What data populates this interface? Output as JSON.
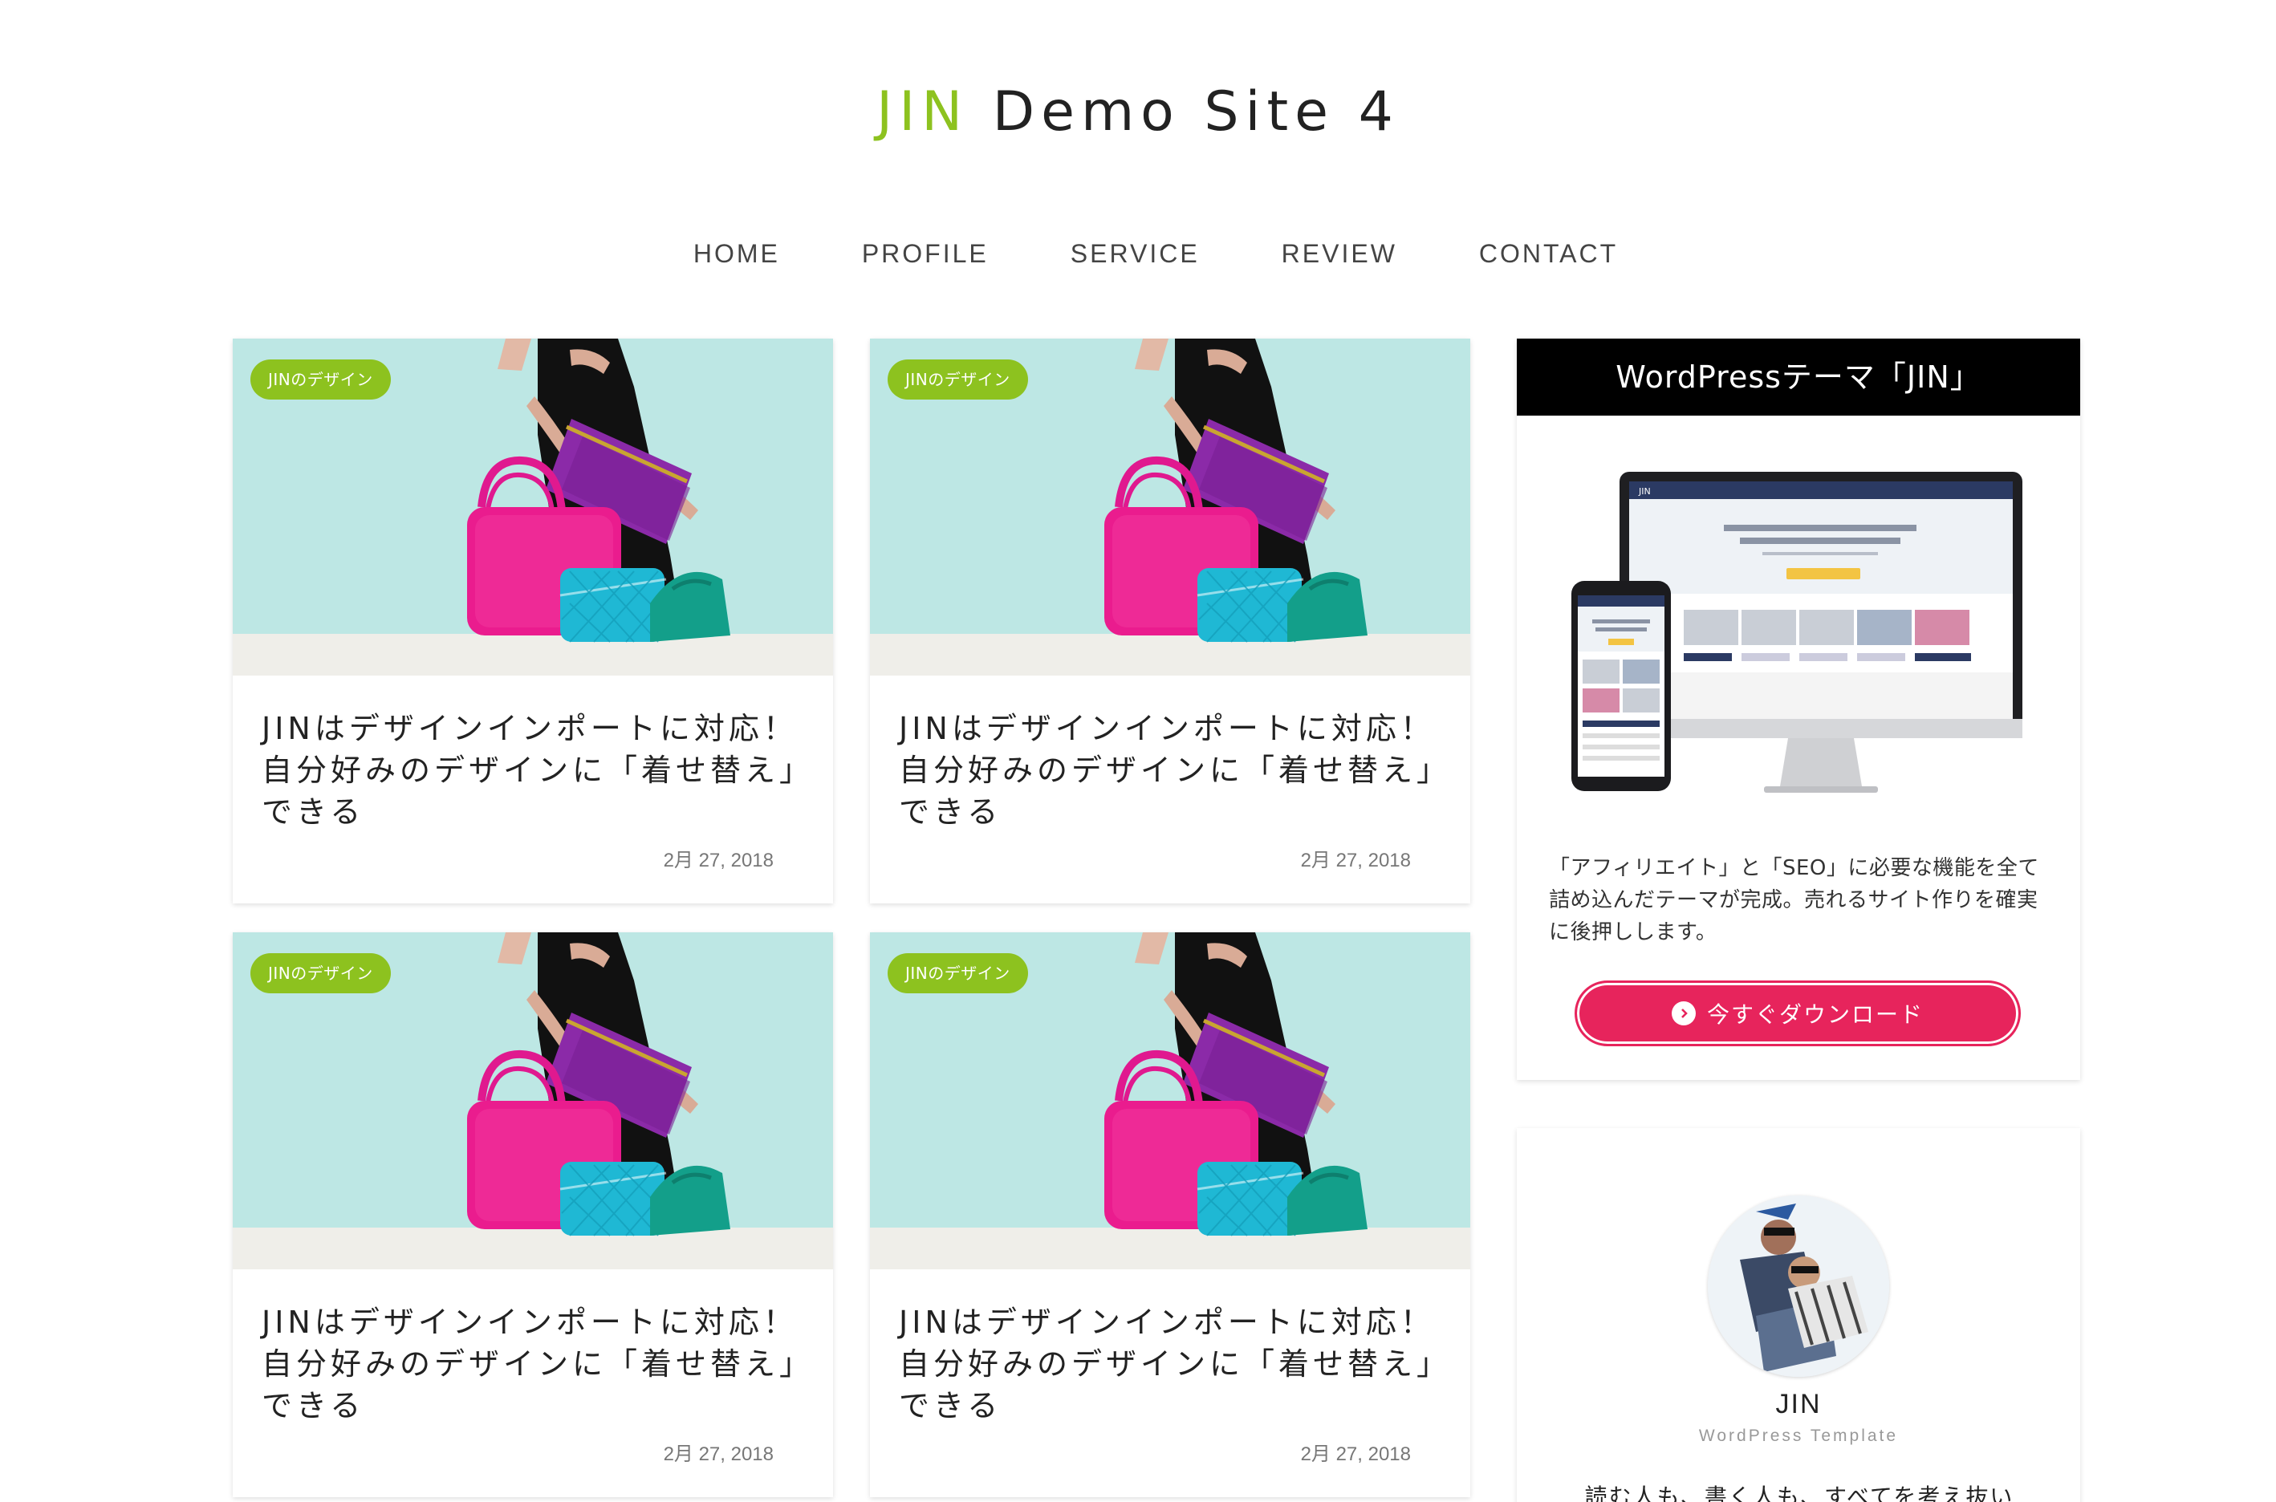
{
  "header": {
    "title_accent": "JIN",
    "title_rest": " Demo Site 4",
    "accent_color": "#8dc21f"
  },
  "nav": {
    "items": [
      "HOME",
      "PROFILE",
      "SERVICE",
      "REVIEW",
      "CONTACT"
    ]
  },
  "posts": [
    {
      "category": "JINのデザイン",
      "title": "JINはデザインインポートに対応！自分好みのデザインに「着せ替え」できる",
      "date": "2月 27, 2018"
    },
    {
      "category": "JINのデザイン",
      "title": "JINはデザインインポートに対応！自分好みのデザインに「着せ替え」できる",
      "date": "2月 27, 2018"
    },
    {
      "category": "JINのデザイン",
      "title": "JINはデザインインポートに対応！自分好みのデザインに「着せ替え」できる",
      "date": "2月 27, 2018"
    },
    {
      "category": "JINのデザイン",
      "title": "JINはデザインインポートに対応！自分好みのデザインに「着せ替え」できる",
      "date": "2月 27, 2018"
    }
  ],
  "sidebar": {
    "theme_widget": {
      "heading": "WordPressテーマ「JIN」",
      "description": "「アフィリエイト」と「SEO」に必要な機能を全て詰め込んだテーマが完成。売れるサイト作りを確実に後押しします。",
      "button_label": "今すぐダウンロード",
      "button_color": "#e7245c",
      "mock_logo": "JIN"
    },
    "profile_widget": {
      "name": "JIN",
      "role": "WordPress Template",
      "bio": "読む人も、書く人も、すべてを考え抜いた"
    }
  }
}
